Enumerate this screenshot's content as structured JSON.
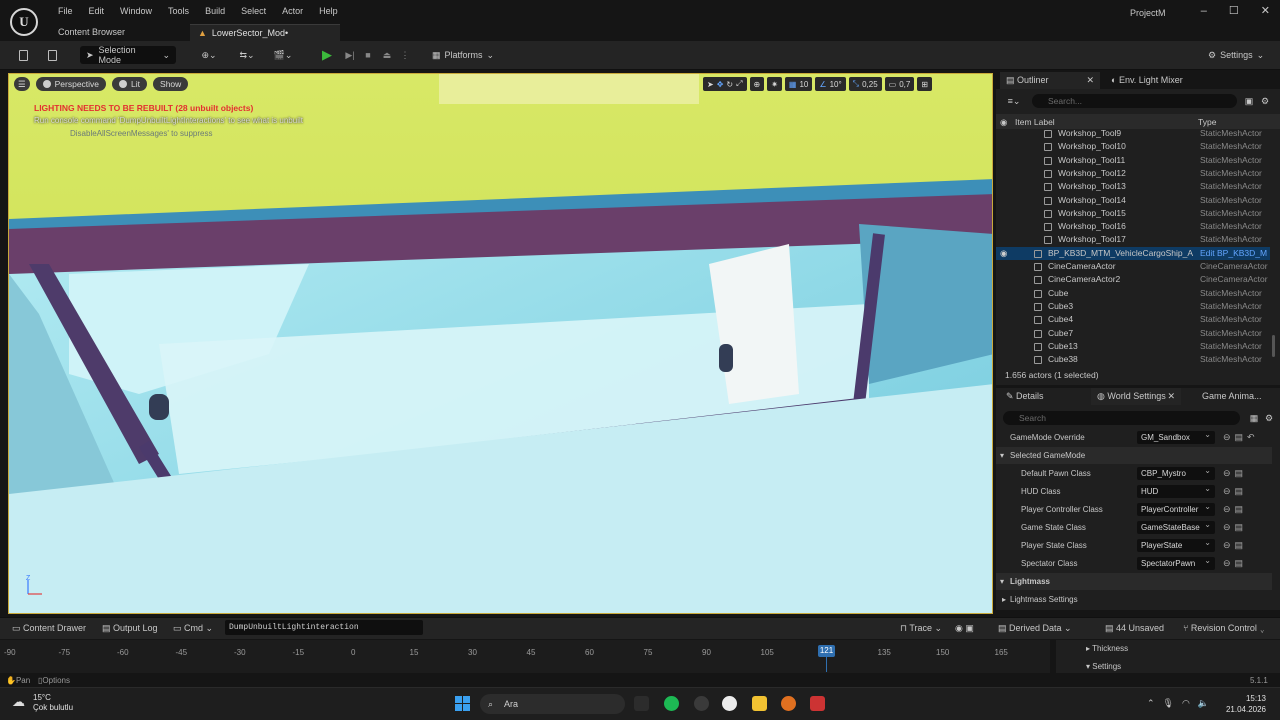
{
  "window": {
    "project_name": "ProjectM",
    "controls": [
      "–",
      "☐",
      "✕"
    ]
  },
  "menu": [
    "File",
    "Edit",
    "Window",
    "Tools",
    "Build",
    "Select",
    "Actor",
    "Help"
  ],
  "doc_tabs": {
    "content_browser": "Content Browser",
    "level": "LowerSector_Mod•"
  },
  "toolbar": {
    "selection_mode": "Selection Mode",
    "platforms": "Platforms",
    "settings": "Settings"
  },
  "viewport": {
    "perspective": "Perspective",
    "lit": "Lit",
    "show": "Show",
    "grid_snap": "10",
    "rotation_snap": "10°",
    "scale_snap": "0,25",
    "camera_speed": "0,7",
    "warning": "LIGHTING NEEDS TO BE REBUILT (28 unbuilt objects)",
    "hint": "Run console command 'DumpUnbuiltLightInteractions' to see what is unbuilt",
    "hint2": "DisableAllScreenMessages' to suppress"
  },
  "outliner": {
    "tab": "Outliner",
    "tab2": "Env. Light Mixer",
    "search_placeholder": "Search...",
    "col_label": "Item Label",
    "col_type": "Type",
    "rows": [
      {
        "name": "Workshop_Tool9",
        "type": "StaticMeshActor"
      },
      {
        "name": "Workshop_Tool10",
        "type": "StaticMeshActor"
      },
      {
        "name": "Workshop_Tool11",
        "type": "StaticMeshActor"
      },
      {
        "name": "Workshop_Tool12",
        "type": "StaticMeshActor"
      },
      {
        "name": "Workshop_Tool13",
        "type": "StaticMeshActor"
      },
      {
        "name": "Workshop_Tool14",
        "type": "StaticMeshActor"
      },
      {
        "name": "Workshop_Tool15",
        "type": "StaticMeshActor"
      },
      {
        "name": "Workshop_Tool16",
        "type": "StaticMeshActor"
      },
      {
        "name": "Workshop_Tool17",
        "type": "StaticMeshActor"
      },
      {
        "name": "BP_KB3D_MTM_VehicleCargoShip_A",
        "type": "Edit BP_KB3D_M"
      },
      {
        "name": "CineCameraActor",
        "type": "CineCameraActor"
      },
      {
        "name": "CineCameraActor2",
        "type": "CineCameraActor"
      },
      {
        "name": "Cube",
        "type": "StaticMeshActor"
      },
      {
        "name": "Cube3",
        "type": "StaticMeshActor"
      },
      {
        "name": "Cube4",
        "type": "StaticMeshActor"
      },
      {
        "name": "Cube7",
        "type": "StaticMeshActor"
      },
      {
        "name": "Cube13",
        "type": "StaticMeshActor"
      },
      {
        "name": "Cube38",
        "type": "StaticMeshActor"
      }
    ],
    "count": "1.656 actors (1 selected)"
  },
  "details": {
    "tab1": "Details",
    "tab2": "World Settings",
    "tab3": "Game Anima...",
    "search_placeholder": "Search",
    "gamemode_override": {
      "label": "GameMode Override",
      "value": "GM_Sandbox"
    },
    "section_selected": "Selected GameMode",
    "props": [
      {
        "label": "Default Pawn Class",
        "value": "CBP_Mystro"
      },
      {
        "label": "HUD Class",
        "value": "HUD"
      },
      {
        "label": "Player Controller Class",
        "value": "PlayerController"
      },
      {
        "label": "Game State Class",
        "value": "GameStateBase"
      },
      {
        "label": "Player State Class",
        "value": "PlayerState"
      },
      {
        "label": "Spectator Class",
        "value": "SpectatorPawn"
      }
    ],
    "section_lightmass": "Lightmass",
    "lightmass_settings": "Lightmass Settings"
  },
  "bottom": {
    "content_drawer": "Content Drawer",
    "output_log": "Output Log",
    "cmd": "Cmd",
    "cmd_value": "DumpUnbuiltLightinteraction",
    "trace": "Trace",
    "derived_data": "Derived Data",
    "unsaved": "44 Unsaved",
    "revision": "Revision Control"
  },
  "timeline": {
    "ticks": [
      "-90",
      "-75",
      "-60",
      "-45",
      "-30",
      "-15",
      "0",
      "15",
      "30",
      "45",
      "60",
      "75",
      "90",
      "105",
      "121",
      "135",
      "150",
      "165"
    ],
    "current": "121",
    "right_rows": [
      "Thickness",
      "Settings"
    ]
  },
  "status": {
    "pan": "Pan",
    "options": "Options",
    "version": "5.1.1"
  },
  "taskbar": {
    "temp": "15°C",
    "weather": "Çok bulutlu",
    "search": "Ara",
    "time": "15:13",
    "date": "21.04.2026"
  }
}
